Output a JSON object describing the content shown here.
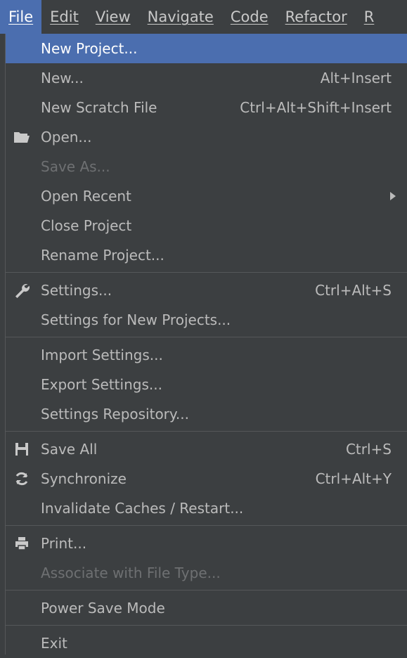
{
  "menubar": [
    {
      "label": "File",
      "active": true
    },
    {
      "label": "Edit"
    },
    {
      "label": "View"
    },
    {
      "label": "Navigate"
    },
    {
      "label": "Code"
    },
    {
      "label": "Refactor"
    },
    {
      "label": "R"
    }
  ],
  "file_menu": {
    "new_project": "New Project...",
    "new": {
      "label": "New...",
      "shortcut": "Alt+Insert"
    },
    "new_scratch_file": {
      "label": "New Scratch File",
      "shortcut": "Ctrl+Alt+Shift+Insert"
    },
    "open": "Open...",
    "save_as": "Save As...",
    "open_recent": "Open Recent",
    "close_project": "Close Project",
    "rename_project": "Rename Project...",
    "settings": {
      "label": "Settings...",
      "shortcut": "Ctrl+Alt+S"
    },
    "settings_new_projects": "Settings for New Projects...",
    "import_settings": "Import Settings...",
    "export_settings": "Export Settings...",
    "settings_repository": "Settings Repository...",
    "save_all": {
      "label": "Save All",
      "shortcut": "Ctrl+S"
    },
    "synchronize": {
      "label": "Synchronize",
      "shortcut": "Ctrl+Alt+Y"
    },
    "invalidate_caches": "Invalidate Caches / Restart...",
    "print": "Print...",
    "associate_file_type": "Associate with File Type...",
    "power_save_mode": "Power Save Mode",
    "exit": "Exit"
  },
  "icons": {
    "open": "folder-icon",
    "settings": "wrench-icon",
    "save_all": "save-icon",
    "synchronize": "sync-icon",
    "print": "printer-icon"
  },
  "colors": {
    "background": "#3c3f41",
    "selection": "#4b6eaf",
    "text": "#bbbbbb",
    "disabled_text": "#6e7072",
    "separator": "#555759"
  }
}
